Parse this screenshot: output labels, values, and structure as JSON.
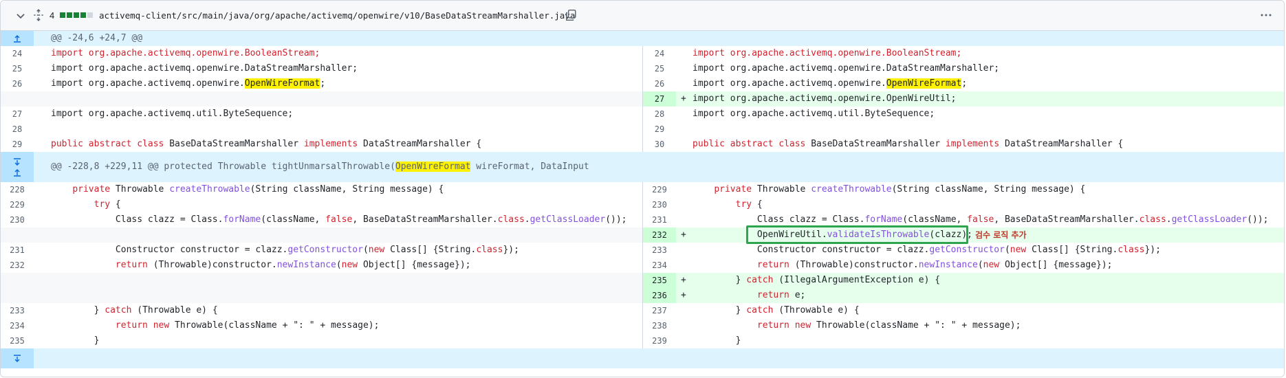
{
  "file": {
    "changes": "4",
    "path": "activemq-client/src/main/java/org/apache/activemq/openwire/v10/BaseDataStreamMarshaller.java",
    "diffstat_colors": [
      "#1a7f37",
      "#1a7f37",
      "#1a7f37",
      "#1a7f37",
      "#d0d7de"
    ]
  },
  "hunks": [
    {
      "header": "@@ -24,6 +24,7 @@"
    },
    {
      "header_prefix": "@@ -228,8 +229,11 @@ protected Throwable tightUnmarsalThrowable(",
      "header_hl": "OpenWireFormat",
      "header_suffix": " wireFormat, DataInput"
    }
  ],
  "lines": {
    "l24": "24",
    "r24": "24",
    "imp_bool": "import org.apache.activemq.openwire.BooleanStream;",
    "l25": "25",
    "r25": "25",
    "imp_dsm": "import org.apache.activemq.openwire.DataStreamMarshaller;",
    "l26": "26",
    "r26": "26",
    "imp_owf_prefix": "import org.apache.activemq.openwire.",
    "imp_owf_hl": "OpenWireFormat",
    "imp_owf_suffix": ";",
    "r27": "27",
    "imp_util": "import org.apache.activemq.openwire.OpenWireUtil;",
    "l27": "27",
    "r28": "28",
    "imp_bseq": "import org.apache.activemq.util.ByteSequence;",
    "l28": "28",
    "r29": "29",
    "l29": "29",
    "r30": "30",
    "cls_public": "public",
    "cls_abstract": "abstract",
    "cls_class": "class",
    "cls_name": "BaseDataStreamMarshaller",
    "cls_impl": "implements",
    "cls_iface": "DataStreamMarshaller {",
    "l228": "228",
    "r229": "229",
    "l229": "229",
    "r230": "230",
    "l230": "230",
    "r231": "231",
    "r232": "232",
    "l231": "231",
    "r233": "233",
    "l232": "232",
    "r234": "234",
    "r235": "235",
    "r236": "236",
    "l233": "233",
    "r237": "237",
    "l234": "234",
    "r238": "238",
    "l235": "235",
    "r239": "239",
    "plus": "+",
    "annotation": "검수 로직 추가"
  }
}
